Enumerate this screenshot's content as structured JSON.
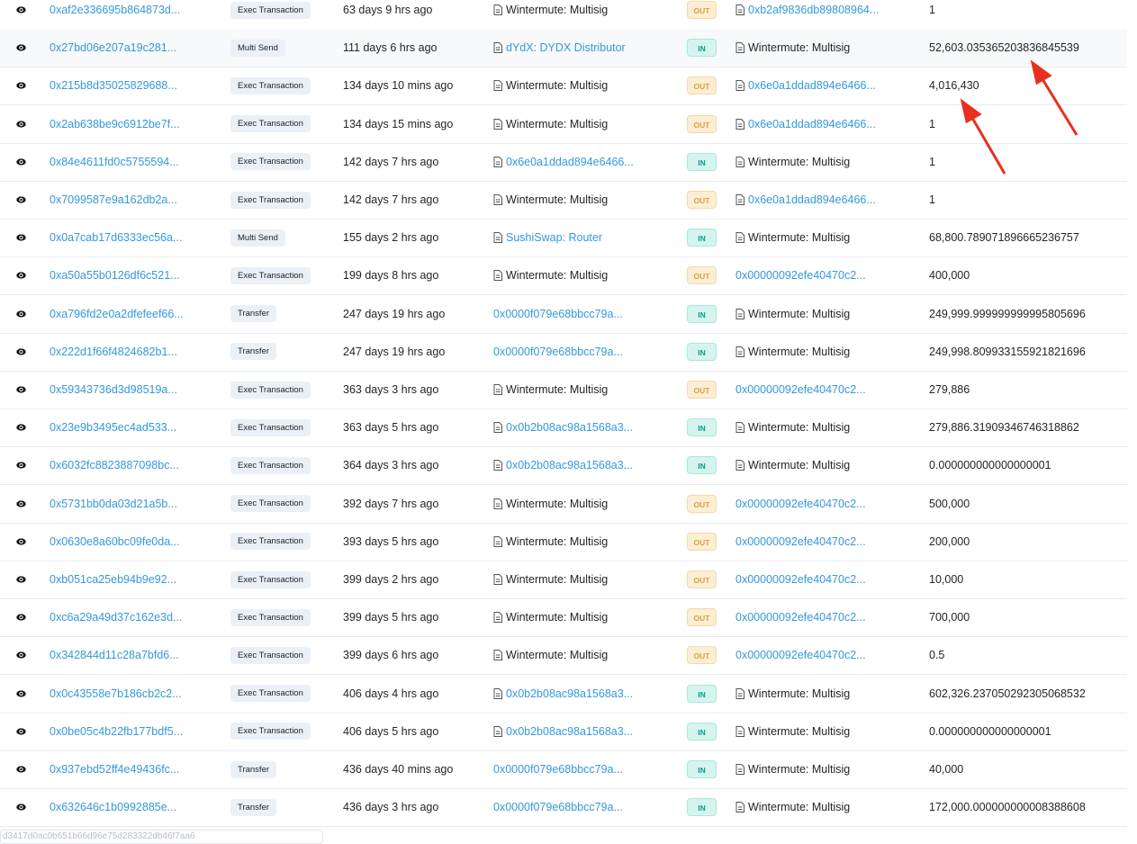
{
  "rows": [
    {
      "hash": "0xaf2e336695b864873d...",
      "method": "Exec Transaction",
      "age": "63 days 9 hrs ago",
      "from": "Wintermute: Multisig",
      "from_link": false,
      "from_doc": true,
      "dir": "OUT",
      "to": "0xb2af9836db89808964...",
      "to_link": true,
      "to_doc": true,
      "value": "1"
    },
    {
      "hash": "0x27bd06e207a19c281...",
      "method": "Multi Send",
      "age": "111 days 6 hrs ago",
      "from": "dYdX: DYDX Distributor",
      "from_link": true,
      "from_doc": true,
      "dir": "IN",
      "to": "Wintermute: Multisig",
      "to_link": false,
      "to_doc": true,
      "value": "52,603.035365203836845539"
    },
    {
      "hash": "0x215b8d35025829688...",
      "method": "Exec Transaction",
      "age": "134 days 10 mins ago",
      "from": "Wintermute: Multisig",
      "from_link": false,
      "from_doc": true,
      "dir": "OUT",
      "to": "0x6e0a1ddad894e6466...",
      "to_link": true,
      "to_doc": true,
      "value": "4,016,430"
    },
    {
      "hash": "0x2ab638be9c6912be7f...",
      "method": "Exec Transaction",
      "age": "134 days 15 mins ago",
      "from": "Wintermute: Multisig",
      "from_link": false,
      "from_doc": true,
      "dir": "OUT",
      "to": "0x6e0a1ddad894e6466...",
      "to_link": true,
      "to_doc": true,
      "value": "1"
    },
    {
      "hash": "0x84e4611fd0c5755594...",
      "method": "Exec Transaction",
      "age": "142 days 7 hrs ago",
      "from": "0x6e0a1ddad894e6466...",
      "from_link": true,
      "from_doc": true,
      "dir": "IN",
      "to": "Wintermute: Multisig",
      "to_link": false,
      "to_doc": true,
      "value": "1"
    },
    {
      "hash": "0x7099587e9a162db2a...",
      "method": "Exec Transaction",
      "age": "142 days 7 hrs ago",
      "from": "Wintermute: Multisig",
      "from_link": false,
      "from_doc": true,
      "dir": "OUT",
      "to": "0x6e0a1ddad894e6466...",
      "to_link": true,
      "to_doc": true,
      "value": "1"
    },
    {
      "hash": "0x0a7cab17d6333ec56a...",
      "method": "Multi Send",
      "age": "155 days 2 hrs ago",
      "from": "SushiSwap: Router",
      "from_link": true,
      "from_doc": true,
      "dir": "IN",
      "to": "Wintermute: Multisig",
      "to_link": false,
      "to_doc": true,
      "value": "68,800.789071896665236757"
    },
    {
      "hash": "0xa50a55b0126df6c521...",
      "method": "Exec Transaction",
      "age": "199 days 8 hrs ago",
      "from": "Wintermute: Multisig",
      "from_link": false,
      "from_doc": true,
      "dir": "OUT",
      "to": "0x00000092efe40470c2...",
      "to_link": true,
      "to_doc": false,
      "value": "400,000"
    },
    {
      "hash": "0xa796fd2e0a2dfefeef66...",
      "method": "Transfer",
      "age": "247 days 19 hrs ago",
      "from": "0x0000f079e68bbcc79a...",
      "from_link": true,
      "from_doc": false,
      "dir": "IN",
      "to": "Wintermute: Multisig",
      "to_link": false,
      "to_doc": true,
      "value": "249,999.999999999995805696"
    },
    {
      "hash": "0x222d1f66f4824682b1...",
      "method": "Transfer",
      "age": "247 days 19 hrs ago",
      "from": "0x0000f079e68bbcc79a...",
      "from_link": true,
      "from_doc": false,
      "dir": "IN",
      "to": "Wintermute: Multisig",
      "to_link": false,
      "to_doc": true,
      "value": "249,998.809933155921821696"
    },
    {
      "hash": "0x59343736d3d98519a...",
      "method": "Exec Transaction",
      "age": "363 days 3 hrs ago",
      "from": "Wintermute: Multisig",
      "from_link": false,
      "from_doc": true,
      "dir": "OUT",
      "to": "0x00000092efe40470c2...",
      "to_link": true,
      "to_doc": false,
      "value": "279,886"
    },
    {
      "hash": "0x23e9b3495ec4ad533...",
      "method": "Exec Transaction",
      "age": "363 days 5 hrs ago",
      "from": "0x0b2b08ac98a1568a3...",
      "from_link": true,
      "from_doc": true,
      "dir": "IN",
      "to": "Wintermute: Multisig",
      "to_link": false,
      "to_doc": true,
      "value": "279,886.31909346746318862"
    },
    {
      "hash": "0x6032fc8823887098bc...",
      "method": "Exec Transaction",
      "age": "364 days 3 hrs ago",
      "from": "0x0b2b08ac98a1568a3...",
      "from_link": true,
      "from_doc": true,
      "dir": "IN",
      "to": "Wintermute: Multisig",
      "to_link": false,
      "to_doc": true,
      "value": "0.000000000000000001"
    },
    {
      "hash": "0x5731bb0da03d21a5b...",
      "method": "Exec Transaction",
      "age": "392 days 7 hrs ago",
      "from": "Wintermute: Multisig",
      "from_link": false,
      "from_doc": true,
      "dir": "OUT",
      "to": "0x00000092efe40470c2...",
      "to_link": true,
      "to_doc": false,
      "value": "500,000"
    },
    {
      "hash": "0x0630e8a60bc09fe0da...",
      "method": "Exec Transaction",
      "age": "393 days 5 hrs ago",
      "from": "Wintermute: Multisig",
      "from_link": false,
      "from_doc": true,
      "dir": "OUT",
      "to": "0x00000092efe40470c2...",
      "to_link": true,
      "to_doc": false,
      "value": "200,000"
    },
    {
      "hash": "0xb051ca25eb94b9e92...",
      "method": "Exec Transaction",
      "age": "399 days 2 hrs ago",
      "from": "Wintermute: Multisig",
      "from_link": false,
      "from_doc": true,
      "dir": "OUT",
      "to": "0x00000092efe40470c2...",
      "to_link": true,
      "to_doc": false,
      "value": "10,000"
    },
    {
      "hash": "0xc6a29a49d37c162e3d...",
      "method": "Exec Transaction",
      "age": "399 days 5 hrs ago",
      "from": "Wintermute: Multisig",
      "from_link": false,
      "from_doc": true,
      "dir": "OUT",
      "to": "0x00000092efe40470c2...",
      "to_link": true,
      "to_doc": false,
      "value": "700,000"
    },
    {
      "hash": "0x342844d11c28a7bfd6...",
      "method": "Exec Transaction",
      "age": "399 days 6 hrs ago",
      "from": "Wintermute: Multisig",
      "from_link": false,
      "from_doc": true,
      "dir": "OUT",
      "to": "0x00000092efe40470c2...",
      "to_link": true,
      "to_doc": false,
      "value": "0.5"
    },
    {
      "hash": "0x0c43558e7b186cb2c2...",
      "method": "Exec Transaction",
      "age": "406 days 4 hrs ago",
      "from": "0x0b2b08ac98a1568a3...",
      "from_link": true,
      "from_doc": true,
      "dir": "IN",
      "to": "Wintermute: Multisig",
      "to_link": false,
      "to_doc": true,
      "value": "602,326.237050292305068532"
    },
    {
      "hash": "0x0be05c4b22fb177bdf5...",
      "method": "Exec Transaction",
      "age": "406 days 5 hrs ago",
      "from": "0x0b2b08ac98a1568a3...",
      "from_link": true,
      "from_doc": true,
      "dir": "IN",
      "to": "Wintermute: Multisig",
      "to_link": false,
      "to_doc": true,
      "value": "0.000000000000000001"
    },
    {
      "hash": "0x937ebd52ff4e49436fc...",
      "method": "Transfer",
      "age": "436 days 40 mins ago",
      "from": "0x0000f079e68bbcc79a...",
      "from_link": true,
      "from_doc": false,
      "dir": "IN",
      "to": "Wintermute: Multisig",
      "to_link": false,
      "to_doc": true,
      "value": "40,000"
    },
    {
      "hash": "0x632646c1b0992885e...",
      "method": "Transfer",
      "age": "436 days 3 hrs ago",
      "from": "0x0000f079e68bbcc79a...",
      "from_link": true,
      "from_doc": false,
      "dir": "IN",
      "to": "Wintermute: Multisig",
      "to_link": false,
      "to_doc": true,
      "value": "172,000.000000000008388608"
    }
  ],
  "highlighted_row_index": 1,
  "footer_text": "d3417d0ac0b651b66d96e75d283322db46f7aa6",
  "colors": {
    "link": "#3498db",
    "out_badge": "#d9a13b",
    "in_badge": "#00a186",
    "annotation_arrow": "#e8301c"
  },
  "icons": {
    "view": "eye-icon",
    "contract": "contract-document-icon"
  }
}
